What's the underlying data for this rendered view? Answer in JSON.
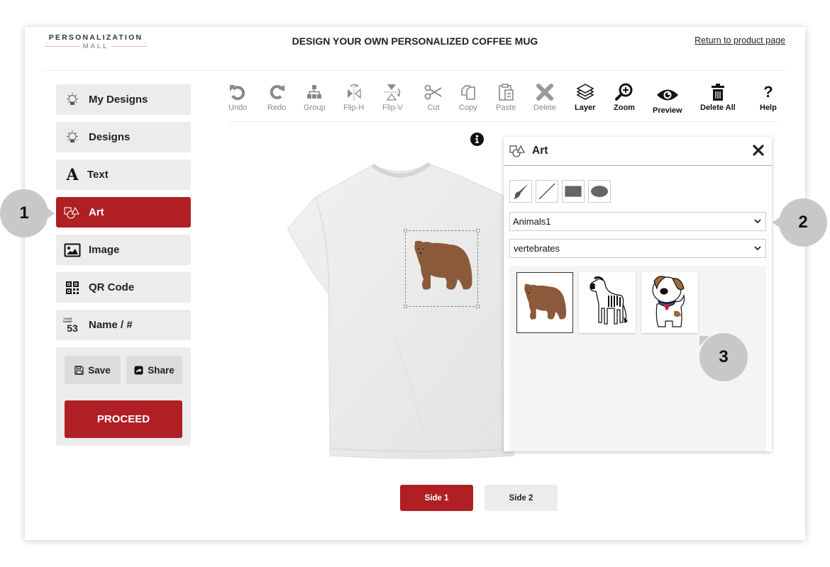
{
  "header": {
    "logo_top": "PERSONALIZATION",
    "logo_bottom": "MALL",
    "title": "DESIGN YOUR OWN PERSONALIZED COFFEE MUG",
    "return_link": "Return to product page"
  },
  "sidebar": {
    "items": [
      {
        "label": "My Designs",
        "icon": "lightbulb-icon",
        "active": false
      },
      {
        "label": "Designs",
        "icon": "lightbulb-icon",
        "active": false
      },
      {
        "label": "Text",
        "icon": "text-a-icon",
        "active": false
      },
      {
        "label": "Art",
        "icon": "shapes-icon",
        "active": true
      },
      {
        "label": "Image",
        "icon": "image-icon",
        "active": false
      },
      {
        "label": "QR Code",
        "icon": "qr-code-icon",
        "active": false
      },
      {
        "label": "Name / #",
        "icon": "name-number-icon",
        "active": false
      }
    ],
    "name_icon_number": "53",
    "save_label": "Save",
    "share_label": "Share",
    "proceed_label": "PROCEED"
  },
  "toolbar": {
    "tools": [
      {
        "label": "Undo",
        "icon": "undo-icon",
        "enabled": false
      },
      {
        "label": "Redo",
        "icon": "redo-icon",
        "enabled": false
      },
      {
        "label": "Group",
        "icon": "group-icon",
        "enabled": false
      },
      {
        "label": "Flip-H",
        "icon": "flip-horizontal-icon",
        "enabled": false
      },
      {
        "label": "Flip-V",
        "icon": "flip-vertical-icon",
        "enabled": false
      },
      {
        "label": "Cut",
        "icon": "scissors-icon",
        "enabled": false
      },
      {
        "label": "Copy",
        "icon": "copy-icon",
        "enabled": false
      },
      {
        "label": "Paste",
        "icon": "paste-icon",
        "enabled": false
      },
      {
        "label": "Delete",
        "icon": "delete-x-icon",
        "enabled": false
      },
      {
        "label": "Layer",
        "icon": "layers-icon",
        "enabled": true
      },
      {
        "label": "Zoom",
        "icon": "zoom-in-icon",
        "enabled": true
      },
      {
        "label": "Preview",
        "icon": "eye-icon",
        "enabled": true
      },
      {
        "label": "Delete All",
        "icon": "trash-icon",
        "enabled": true
      },
      {
        "label": "Help",
        "icon": "question-icon",
        "enabled": true
      }
    ]
  },
  "canvas": {
    "product": "white t-shirt",
    "placed_art": "bear"
  },
  "art_panel": {
    "title": "Art",
    "shape_tools": [
      "brush-icon",
      "line-icon",
      "rectangle-icon",
      "ellipse-icon"
    ],
    "category_select": {
      "value": "Animals1"
    },
    "subcategory_select": {
      "value": "vertebrates"
    },
    "thumbnails": [
      {
        "name": "bear",
        "selected": true
      },
      {
        "name": "zebra",
        "selected": false
      },
      {
        "name": "dog",
        "selected": false
      }
    ]
  },
  "sides": {
    "side1_label": "Side 1",
    "side2_label": "Side 2",
    "active": "Side 1"
  },
  "callouts": {
    "c1": "1",
    "c2": "2",
    "c3": "3"
  },
  "colors": {
    "brand_red": "#b01f23",
    "panel_gray": "#ececec",
    "callout_gray": "#c8c8c8"
  }
}
